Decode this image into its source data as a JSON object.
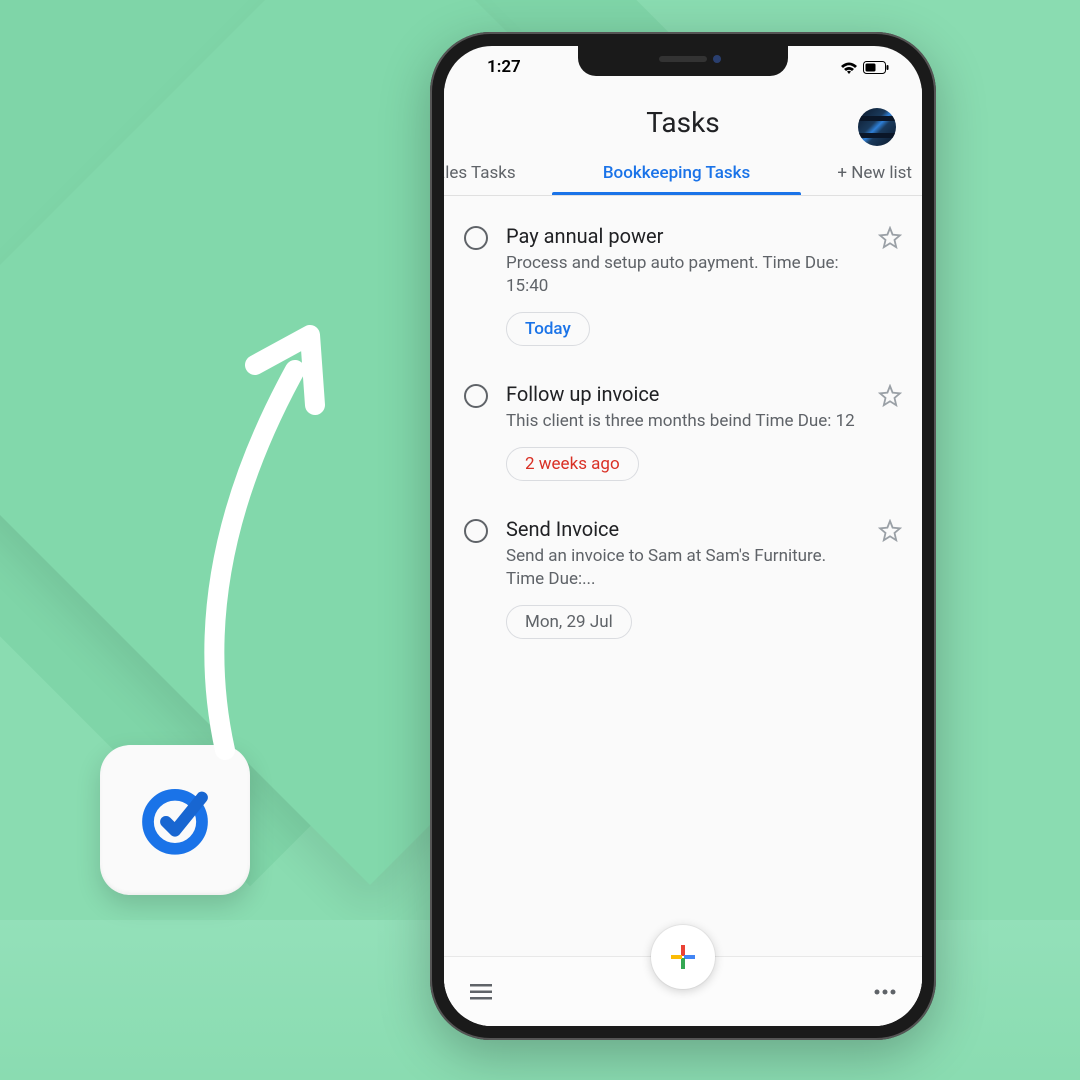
{
  "status": {
    "time": "1:27"
  },
  "header": {
    "title": "Tasks"
  },
  "tabs": {
    "items": [
      {
        "label": "ales Tasks",
        "active": false
      },
      {
        "label": "Bookkeeping Tasks",
        "active": true
      },
      {
        "label": "+ New list",
        "active": false
      }
    ]
  },
  "tasks": [
    {
      "title": "Pay annual power",
      "description": "Process and setup auto payment. Time Due: 15:40",
      "chip": "Today",
      "chipStyle": "blue"
    },
    {
      "title": "Follow up invoice",
      "description": "This client is three months beind Time Due: 12",
      "chip": "2 weeks ago",
      "chipStyle": "red"
    },
    {
      "title": "Send Invoice",
      "description": "Send an invoice to Sam at Sam's Furniture. Time Due:...",
      "chip": "Mon, 29 Jul",
      "chipStyle": "grey"
    }
  ],
  "colors": {
    "blue": "#1a73e8",
    "google_red": "#EA4335",
    "google_yellow": "#FBBC05",
    "google_green": "#34A853",
    "google_blue": "#4285F4"
  }
}
